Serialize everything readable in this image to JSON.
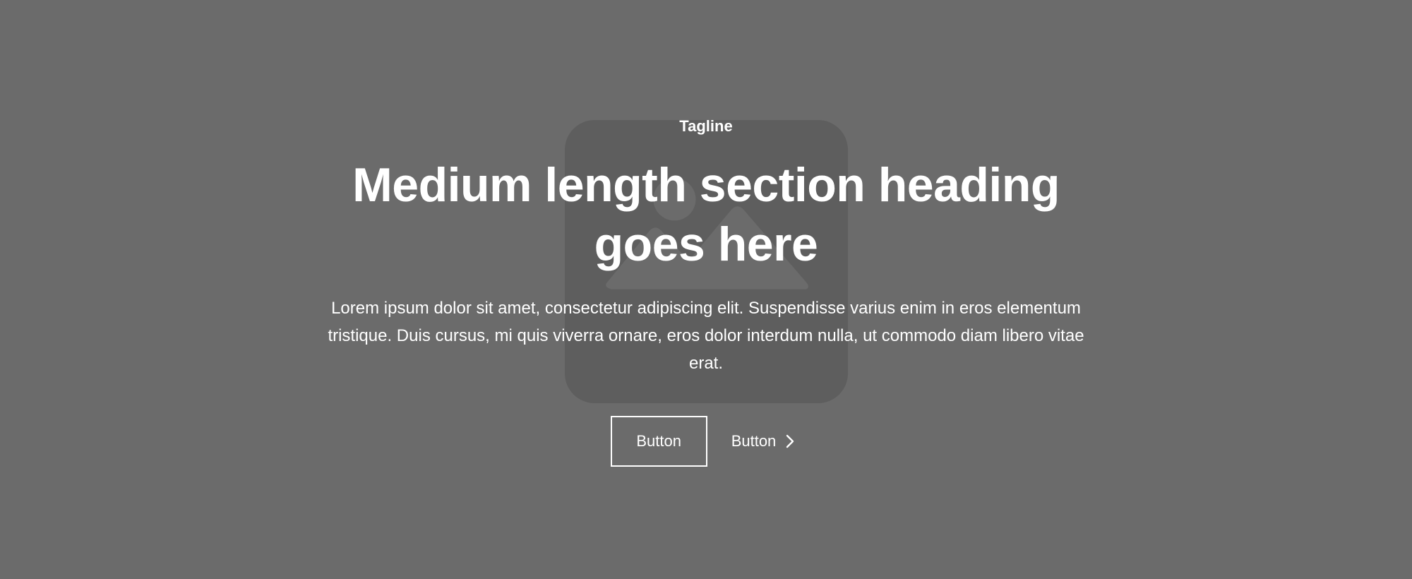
{
  "hero": {
    "background_color": "#6b6b6b",
    "placeholder_icon": "image-placeholder-icon",
    "tagline": "Tagline",
    "heading": "Medium length section heading goes here",
    "description": "Lorem ipsum dolor sit amet, consectetur adipiscing elit. Suspendisse varius enim in eros elementum tristique. Duis cursus, mi quis viverra ornare, eros dolor interdum nulla, ut commodo diam libero vitae erat."
  },
  "actions": {
    "primary_label": "Button",
    "secondary_label": "Button",
    "secondary_icon": "chevron-right-icon"
  }
}
